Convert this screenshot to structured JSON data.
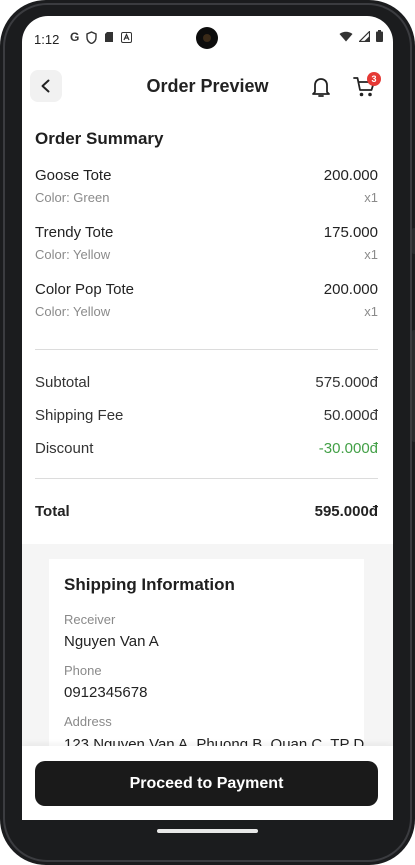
{
  "status_bar": {
    "time": "1:12",
    "icons": [
      "google-g-icon",
      "shield-icon",
      "sim-card-icon",
      "a-badge-icon"
    ],
    "right_icons": [
      "wifi-icon",
      "signal-icon",
      "battery-icon"
    ]
  },
  "header": {
    "title": "Order Preview",
    "cart_count": "3"
  },
  "summary": {
    "title": "Order Summary",
    "items": [
      {
        "name": "Goose Tote",
        "price": "200.000",
        "color": "Color: Green",
        "qty": "x1"
      },
      {
        "name": "Trendy Tote",
        "price": "175.000",
        "color": "Color: Yellow",
        "qty": "x1"
      },
      {
        "name": "Color Pop Tote",
        "price": "200.000",
        "color": "Color: Yellow",
        "qty": "x1"
      }
    ],
    "subtotal_label": "Subtotal",
    "subtotal_value": "575.000đ",
    "shipping_label": "Shipping Fee",
    "shipping_value": "50.000đ",
    "discount_label": "Discount",
    "discount_value": "-30.000đ",
    "total_label": "Total",
    "total_value": "595.000đ"
  },
  "shipping": {
    "title": "Shipping Information",
    "receiver_label": "Receiver",
    "receiver_value": "Nguyen Van A",
    "phone_label": "Phone",
    "phone_value": "0912345678",
    "address_label": "Address",
    "address_value": "123 Nguyen Van A, Phuong B, Quan C, TP D"
  },
  "footer": {
    "button_label": "Proceed to Payment"
  },
  "colors": {
    "accent_dark": "#1a1a1a",
    "discount_green": "#43a047",
    "badge_red": "#e53935"
  }
}
